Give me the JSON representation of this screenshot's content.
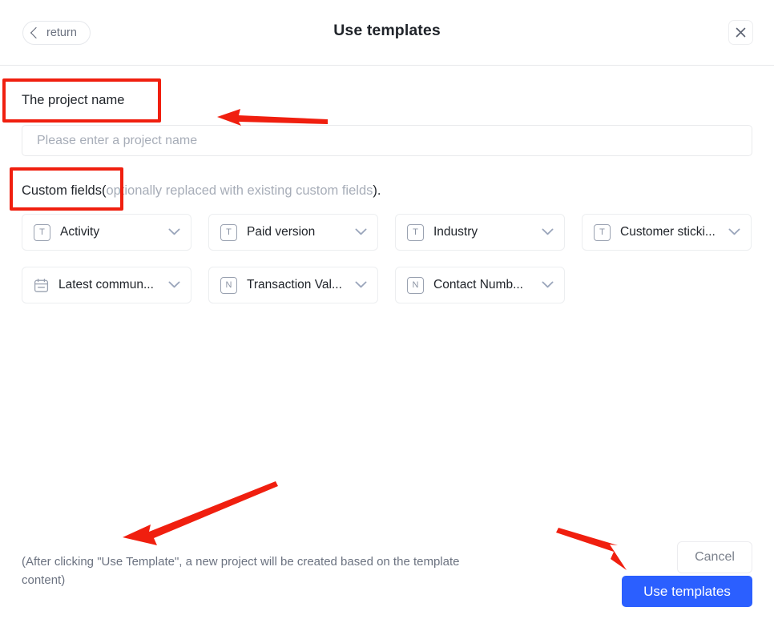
{
  "header": {
    "return_label": "return",
    "title": "Use templates",
    "back_icon": "chevron-left-icon",
    "close_icon": "close-icon"
  },
  "form": {
    "project_name_label": "The project name",
    "project_name_value": "",
    "project_name_placeholder": "Please enter a project name",
    "custom_fields_label": "Custom fields",
    "custom_fields_hint_open": "(",
    "custom_fields_hint": "optionally replaced with existing custom fields",
    "custom_fields_hint_close": ").",
    "fields": [
      {
        "label": "Activity",
        "icon": "text-field-icon",
        "icon_glyph": "T"
      },
      {
        "label": "Paid version",
        "icon": "text-field-icon",
        "icon_glyph": "T"
      },
      {
        "label": "Industry",
        "icon": "text-field-icon",
        "icon_glyph": "T"
      },
      {
        "label": "Customer sticki...",
        "icon": "text-field-icon",
        "icon_glyph": "T"
      },
      {
        "label": "Latest commun...",
        "icon": "calendar-icon",
        "icon_glyph": ""
      },
      {
        "label": "Transaction Val...",
        "icon": "number-field-icon",
        "icon_glyph": "N"
      },
      {
        "label": "Contact Numb...",
        "icon": "number-field-icon",
        "icon_glyph": "N"
      }
    ]
  },
  "footer": {
    "note": "(After clicking \"Use Template\", a new project will be created based on the template content)",
    "cancel_label": "Cancel",
    "submit_label": "Use templates"
  },
  "colors": {
    "primary": "#2b5fff",
    "annotation": "#f01f0f",
    "text": "#1f2329",
    "muted": "#a7adb8",
    "border": "#eceef0"
  }
}
